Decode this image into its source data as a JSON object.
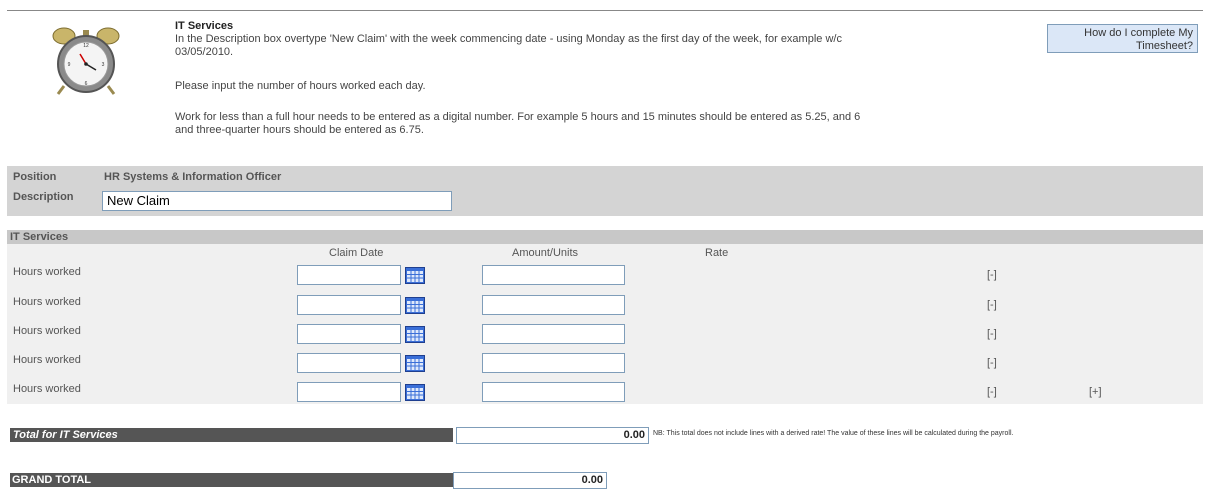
{
  "header": {
    "title": "IT Services",
    "line1": "In the Description box overtype 'New Claim' with the week commencing date - using Monday as the first day of the week, for example w/c",
    "line1b": "03/05/2010.",
    "line2": "Please input the number of hours worked each day.",
    "line3": "Work for less than a full hour needs to be entered as a digital number. For example 5 hours and 15 minutes should be entered as 5.25, and 6",
    "line3b": "and three-quarter hours should be entered as 6.75.",
    "help_line1": "How do I complete My",
    "help_line2": "Timesheet?",
    "clock_icon": "alarm-clock-icon"
  },
  "position": {
    "label": "Position",
    "value": "HR Systems & Information Officer",
    "description_label": "Description",
    "description_value": "New Claim"
  },
  "section": {
    "title": "IT Services",
    "col_claim_date": "Claim Date",
    "col_amount": "Amount/Units",
    "col_rate": "Rate",
    "rows": [
      {
        "label": "Hours worked",
        "remove": "[-]",
        "add": ""
      },
      {
        "label": "Hours worked",
        "remove": "[-]",
        "add": ""
      },
      {
        "label": "Hours worked",
        "remove": "[-]",
        "add": ""
      },
      {
        "label": "Hours worked",
        "remove": "[-]",
        "add": ""
      },
      {
        "label": "Hours worked",
        "remove": "[-]",
        "add": "[+]"
      }
    ],
    "calendar_icon": "calendar-icon"
  },
  "totals": {
    "section_total_label": "Total for IT Services",
    "section_total_value": "0.00",
    "note": "NB: This total does not include lines with a derived rate! The value of these lines will be calculated during the payroll.",
    "grand_total_label": "GRAND TOTAL",
    "grand_total_value": "0.00"
  }
}
